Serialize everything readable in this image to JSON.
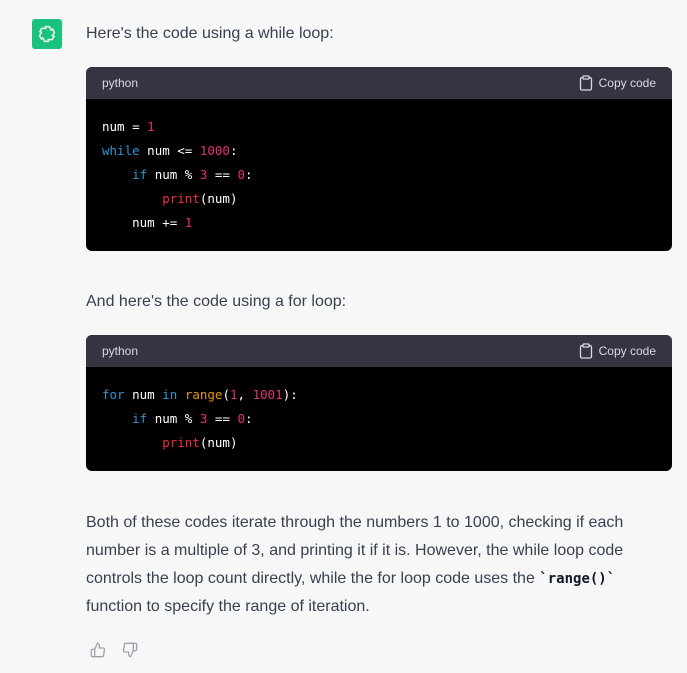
{
  "message": {
    "intro_while": "Here's the code using a while loop:",
    "intro_for": "And here's the code using a for loop:",
    "summary_part1": "Both of these codes iterate through the numbers 1 to 1000, checking if each number is a multiple of 3, and printing it if it is. However, the while loop code controls the loop count directly, while the for loop code uses the ",
    "summary_code": "`range()`",
    "summary_part2": " function to specify the range of iteration."
  },
  "code_blocks": [
    {
      "language": "python",
      "copy_label": "Copy code",
      "lines": [
        [
          {
            "t": "num = ",
            "c": "plain"
          },
          {
            "t": "1",
            "c": "num"
          }
        ],
        [
          {
            "t": "while",
            "c": "kw"
          },
          {
            "t": " num <= ",
            "c": "plain"
          },
          {
            "t": "1000",
            "c": "num"
          },
          {
            "t": ":",
            "c": "plain"
          }
        ],
        [
          {
            "t": "    ",
            "c": "plain"
          },
          {
            "t": "if",
            "c": "kw"
          },
          {
            "t": " num % ",
            "c": "plain"
          },
          {
            "t": "3",
            "c": "num"
          },
          {
            "t": " == ",
            "c": "plain"
          },
          {
            "t": "0",
            "c": "num"
          },
          {
            "t": ":",
            "c": "plain"
          }
        ],
        [
          {
            "t": "        ",
            "c": "plain"
          },
          {
            "t": "print",
            "c": "fn"
          },
          {
            "t": "(num)",
            "c": "plain"
          }
        ],
        [
          {
            "t": "    num += ",
            "c": "plain"
          },
          {
            "t": "1",
            "c": "num"
          }
        ]
      ]
    },
    {
      "language": "python",
      "copy_label": "Copy code",
      "lines": [
        [
          {
            "t": "for",
            "c": "kw"
          },
          {
            "t": " num ",
            "c": "plain"
          },
          {
            "t": "in",
            "c": "kw"
          },
          {
            "t": " ",
            "c": "plain"
          },
          {
            "t": "range",
            "c": "bi"
          },
          {
            "t": "(",
            "c": "plain"
          },
          {
            "t": "1",
            "c": "num"
          },
          {
            "t": ", ",
            "c": "plain"
          },
          {
            "t": "1001",
            "c": "num"
          },
          {
            "t": "):",
            "c": "plain"
          }
        ],
        [
          {
            "t": "    ",
            "c": "plain"
          },
          {
            "t": "if",
            "c": "kw"
          },
          {
            "t": " num % ",
            "c": "plain"
          },
          {
            "t": "3",
            "c": "num"
          },
          {
            "t": " == ",
            "c": "plain"
          },
          {
            "t": "0",
            "c": "num"
          },
          {
            "t": ":",
            "c": "plain"
          }
        ],
        [
          {
            "t": "        ",
            "c": "plain"
          },
          {
            "t": "print",
            "c": "fn"
          },
          {
            "t": "(num)",
            "c": "plain"
          }
        ]
      ]
    }
  ],
  "colors": {
    "avatar_bg": "#19c37d",
    "keyword": "#2e95d3",
    "number": "#df3079",
    "function": "#f22c3d",
    "builtin": "#e9950c"
  },
  "icons": {
    "avatar": "openai-logo-icon",
    "copy": "clipboard-icon",
    "like": "thumbs-up-icon",
    "dislike": "thumbs-down-icon"
  }
}
